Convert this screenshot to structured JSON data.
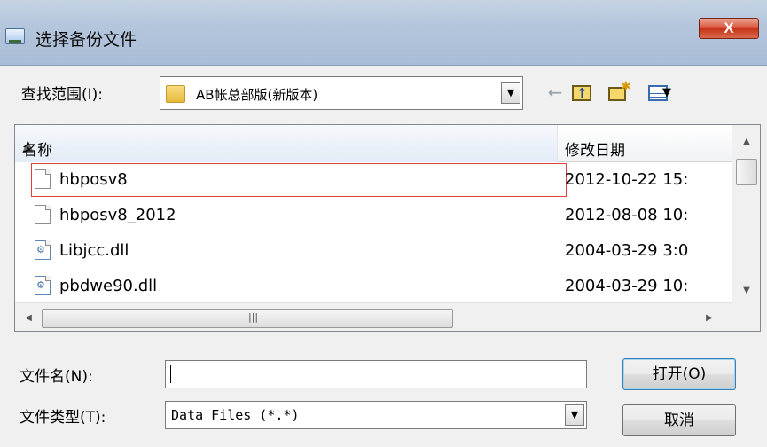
{
  "window": {
    "title": "选择备份文件",
    "close_glyph": "X"
  },
  "lookin": {
    "label": "查找范围(I):",
    "value": "AB帐总部版(新版本)"
  },
  "toolbar": {
    "back_glyph": "←"
  },
  "list": {
    "columns": {
      "name": "名称",
      "date": "修改日期"
    },
    "rows": [
      {
        "name": "hbposv8",
        "date": "2012-10-22 15:",
        "icon": "file-icon",
        "selected": true
      },
      {
        "name": "hbposv8_2012",
        "date": "2012-08-08 10:",
        "icon": "file-icon",
        "selected": false
      },
      {
        "name": "Libjcc.dll",
        "date": "2004-03-29 3:0",
        "icon": "dll-icon",
        "selected": false
      },
      {
        "name": "pbdwe90.dll",
        "date": "2004-03-29 10:",
        "icon": "dll-icon",
        "selected": false
      }
    ]
  },
  "filename": {
    "label": "文件名(N):",
    "value": ""
  },
  "filetype": {
    "label": "文件类型(T):",
    "value": "Data Files (*.*)"
  },
  "buttons": {
    "open": "打开(O)",
    "cancel": "取消"
  },
  "colors": {
    "selection_frame": "#e0413a",
    "close_button": "#c73318"
  }
}
